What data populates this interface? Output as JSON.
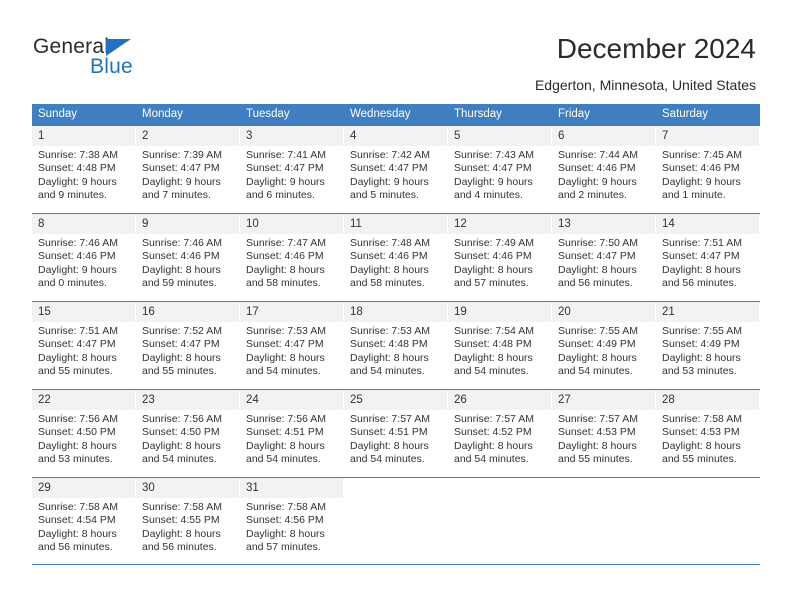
{
  "brand": {
    "general": "General",
    "blue": "Blue",
    "triangle_icon": "blue-triangle-icon",
    "accent_color": "#1f74bd"
  },
  "header": {
    "title": "December 2024",
    "subtitle": "Edgerton, Minnesota, United States"
  },
  "calendar": {
    "header_bg": "#3f7fc1",
    "daynum_bg": "#f2f2f2",
    "weekdays": [
      "Sunday",
      "Monday",
      "Tuesday",
      "Wednesday",
      "Thursday",
      "Friday",
      "Saturday"
    ],
    "weeks": [
      [
        {
          "day": "1",
          "sunrise": "Sunrise: 7:38 AM",
          "sunset": "Sunset: 4:48 PM",
          "daylight1": "Daylight: 9 hours",
          "daylight2": "and 9 minutes."
        },
        {
          "day": "2",
          "sunrise": "Sunrise: 7:39 AM",
          "sunset": "Sunset: 4:47 PM",
          "daylight1": "Daylight: 9 hours",
          "daylight2": "and 7 minutes."
        },
        {
          "day": "3",
          "sunrise": "Sunrise: 7:41 AM",
          "sunset": "Sunset: 4:47 PM",
          "daylight1": "Daylight: 9 hours",
          "daylight2": "and 6 minutes."
        },
        {
          "day": "4",
          "sunrise": "Sunrise: 7:42 AM",
          "sunset": "Sunset: 4:47 PM",
          "daylight1": "Daylight: 9 hours",
          "daylight2": "and 5 minutes."
        },
        {
          "day": "5",
          "sunrise": "Sunrise: 7:43 AM",
          "sunset": "Sunset: 4:47 PM",
          "daylight1": "Daylight: 9 hours",
          "daylight2": "and 4 minutes."
        },
        {
          "day": "6",
          "sunrise": "Sunrise: 7:44 AM",
          "sunset": "Sunset: 4:46 PM",
          "daylight1": "Daylight: 9 hours",
          "daylight2": "and 2 minutes."
        },
        {
          "day": "7",
          "sunrise": "Sunrise: 7:45 AM",
          "sunset": "Sunset: 4:46 PM",
          "daylight1": "Daylight: 9 hours",
          "daylight2": "and 1 minute."
        }
      ],
      [
        {
          "day": "8",
          "sunrise": "Sunrise: 7:46 AM",
          "sunset": "Sunset: 4:46 PM",
          "daylight1": "Daylight: 9 hours",
          "daylight2": "and 0 minutes."
        },
        {
          "day": "9",
          "sunrise": "Sunrise: 7:46 AM",
          "sunset": "Sunset: 4:46 PM",
          "daylight1": "Daylight: 8 hours",
          "daylight2": "and 59 minutes."
        },
        {
          "day": "10",
          "sunrise": "Sunrise: 7:47 AM",
          "sunset": "Sunset: 4:46 PM",
          "daylight1": "Daylight: 8 hours",
          "daylight2": "and 58 minutes."
        },
        {
          "day": "11",
          "sunrise": "Sunrise: 7:48 AM",
          "sunset": "Sunset: 4:46 PM",
          "daylight1": "Daylight: 8 hours",
          "daylight2": "and 58 minutes."
        },
        {
          "day": "12",
          "sunrise": "Sunrise: 7:49 AM",
          "sunset": "Sunset: 4:46 PM",
          "daylight1": "Daylight: 8 hours",
          "daylight2": "and 57 minutes."
        },
        {
          "day": "13",
          "sunrise": "Sunrise: 7:50 AM",
          "sunset": "Sunset: 4:47 PM",
          "daylight1": "Daylight: 8 hours",
          "daylight2": "and 56 minutes."
        },
        {
          "day": "14",
          "sunrise": "Sunrise: 7:51 AM",
          "sunset": "Sunset: 4:47 PM",
          "daylight1": "Daylight: 8 hours",
          "daylight2": "and 56 minutes."
        }
      ],
      [
        {
          "day": "15",
          "sunrise": "Sunrise: 7:51 AM",
          "sunset": "Sunset: 4:47 PM",
          "daylight1": "Daylight: 8 hours",
          "daylight2": "and 55 minutes."
        },
        {
          "day": "16",
          "sunrise": "Sunrise: 7:52 AM",
          "sunset": "Sunset: 4:47 PM",
          "daylight1": "Daylight: 8 hours",
          "daylight2": "and 55 minutes."
        },
        {
          "day": "17",
          "sunrise": "Sunrise: 7:53 AM",
          "sunset": "Sunset: 4:47 PM",
          "daylight1": "Daylight: 8 hours",
          "daylight2": "and 54 minutes."
        },
        {
          "day": "18",
          "sunrise": "Sunrise: 7:53 AM",
          "sunset": "Sunset: 4:48 PM",
          "daylight1": "Daylight: 8 hours",
          "daylight2": "and 54 minutes."
        },
        {
          "day": "19",
          "sunrise": "Sunrise: 7:54 AM",
          "sunset": "Sunset: 4:48 PM",
          "daylight1": "Daylight: 8 hours",
          "daylight2": "and 54 minutes."
        },
        {
          "day": "20",
          "sunrise": "Sunrise: 7:55 AM",
          "sunset": "Sunset: 4:49 PM",
          "daylight1": "Daylight: 8 hours",
          "daylight2": "and 54 minutes."
        },
        {
          "day": "21",
          "sunrise": "Sunrise: 7:55 AM",
          "sunset": "Sunset: 4:49 PM",
          "daylight1": "Daylight: 8 hours",
          "daylight2": "and 53 minutes."
        }
      ],
      [
        {
          "day": "22",
          "sunrise": "Sunrise: 7:56 AM",
          "sunset": "Sunset: 4:50 PM",
          "daylight1": "Daylight: 8 hours",
          "daylight2": "and 53 minutes."
        },
        {
          "day": "23",
          "sunrise": "Sunrise: 7:56 AM",
          "sunset": "Sunset: 4:50 PM",
          "daylight1": "Daylight: 8 hours",
          "daylight2": "and 54 minutes."
        },
        {
          "day": "24",
          "sunrise": "Sunrise: 7:56 AM",
          "sunset": "Sunset: 4:51 PM",
          "daylight1": "Daylight: 8 hours",
          "daylight2": "and 54 minutes."
        },
        {
          "day": "25",
          "sunrise": "Sunrise: 7:57 AM",
          "sunset": "Sunset: 4:51 PM",
          "daylight1": "Daylight: 8 hours",
          "daylight2": "and 54 minutes."
        },
        {
          "day": "26",
          "sunrise": "Sunrise: 7:57 AM",
          "sunset": "Sunset: 4:52 PM",
          "daylight1": "Daylight: 8 hours",
          "daylight2": "and 54 minutes."
        },
        {
          "day": "27",
          "sunrise": "Sunrise: 7:57 AM",
          "sunset": "Sunset: 4:53 PM",
          "daylight1": "Daylight: 8 hours",
          "daylight2": "and 55 minutes."
        },
        {
          "day": "28",
          "sunrise": "Sunrise: 7:58 AM",
          "sunset": "Sunset: 4:53 PM",
          "daylight1": "Daylight: 8 hours",
          "daylight2": "and 55 minutes."
        }
      ],
      [
        {
          "day": "29",
          "sunrise": "Sunrise: 7:58 AM",
          "sunset": "Sunset: 4:54 PM",
          "daylight1": "Daylight: 8 hours",
          "daylight2": "and 56 minutes."
        },
        {
          "day": "30",
          "sunrise": "Sunrise: 7:58 AM",
          "sunset": "Sunset: 4:55 PM",
          "daylight1": "Daylight: 8 hours",
          "daylight2": "and 56 minutes."
        },
        {
          "day": "31",
          "sunrise": "Sunrise: 7:58 AM",
          "sunset": "Sunset: 4:56 PM",
          "daylight1": "Daylight: 8 hours",
          "daylight2": "and 57 minutes."
        },
        {
          "day": "",
          "sunrise": "",
          "sunset": "",
          "daylight1": "",
          "daylight2": ""
        },
        {
          "day": "",
          "sunrise": "",
          "sunset": "",
          "daylight1": "",
          "daylight2": ""
        },
        {
          "day": "",
          "sunrise": "",
          "sunset": "",
          "daylight1": "",
          "daylight2": ""
        },
        {
          "day": "",
          "sunrise": "",
          "sunset": "",
          "daylight1": "",
          "daylight2": ""
        }
      ]
    ]
  }
}
